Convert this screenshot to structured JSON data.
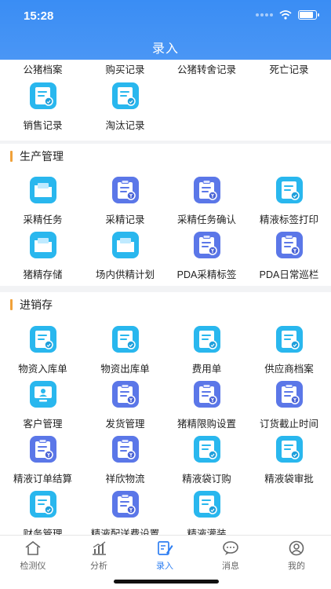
{
  "status": {
    "time": "15:28"
  },
  "header": {
    "title": "录入"
  },
  "top_section": {
    "row1": [
      "公猪档案",
      "购买记录",
      "公猪转舍记录",
      "死亡记录"
    ],
    "row2": [
      "销售记录",
      "淘汰记录"
    ]
  },
  "production": {
    "title": "生产管理",
    "items": [
      "采精任务",
      "采精记录",
      "采精任务确认",
      "精液标签打印",
      "猪精存储",
      "场内供精计划",
      "PDA采精标签",
      "PDA日常巡栏"
    ]
  },
  "sales": {
    "title": "进销存",
    "items": [
      "物资入库单",
      "物资出库单",
      "费用单",
      "供应商档案",
      "客户管理",
      "发货管理",
      "猪精限购设置",
      "订货截止时间",
      "精液订单结算",
      "祥欣物流",
      "精液袋订购",
      "精液袋审批",
      "财务管理",
      "精液配送费设置",
      "精液灌装"
    ]
  },
  "tabbar": {
    "tabs": [
      "检测仪",
      "分析",
      "录入",
      "消息",
      "我的"
    ]
  },
  "colors": {
    "accent": "#2f7ff2",
    "header": "#3a8df4",
    "section_bar": "#f0a139",
    "icon_cyan": "#29b7ee",
    "icon_indigo": "#5b77e8"
  }
}
